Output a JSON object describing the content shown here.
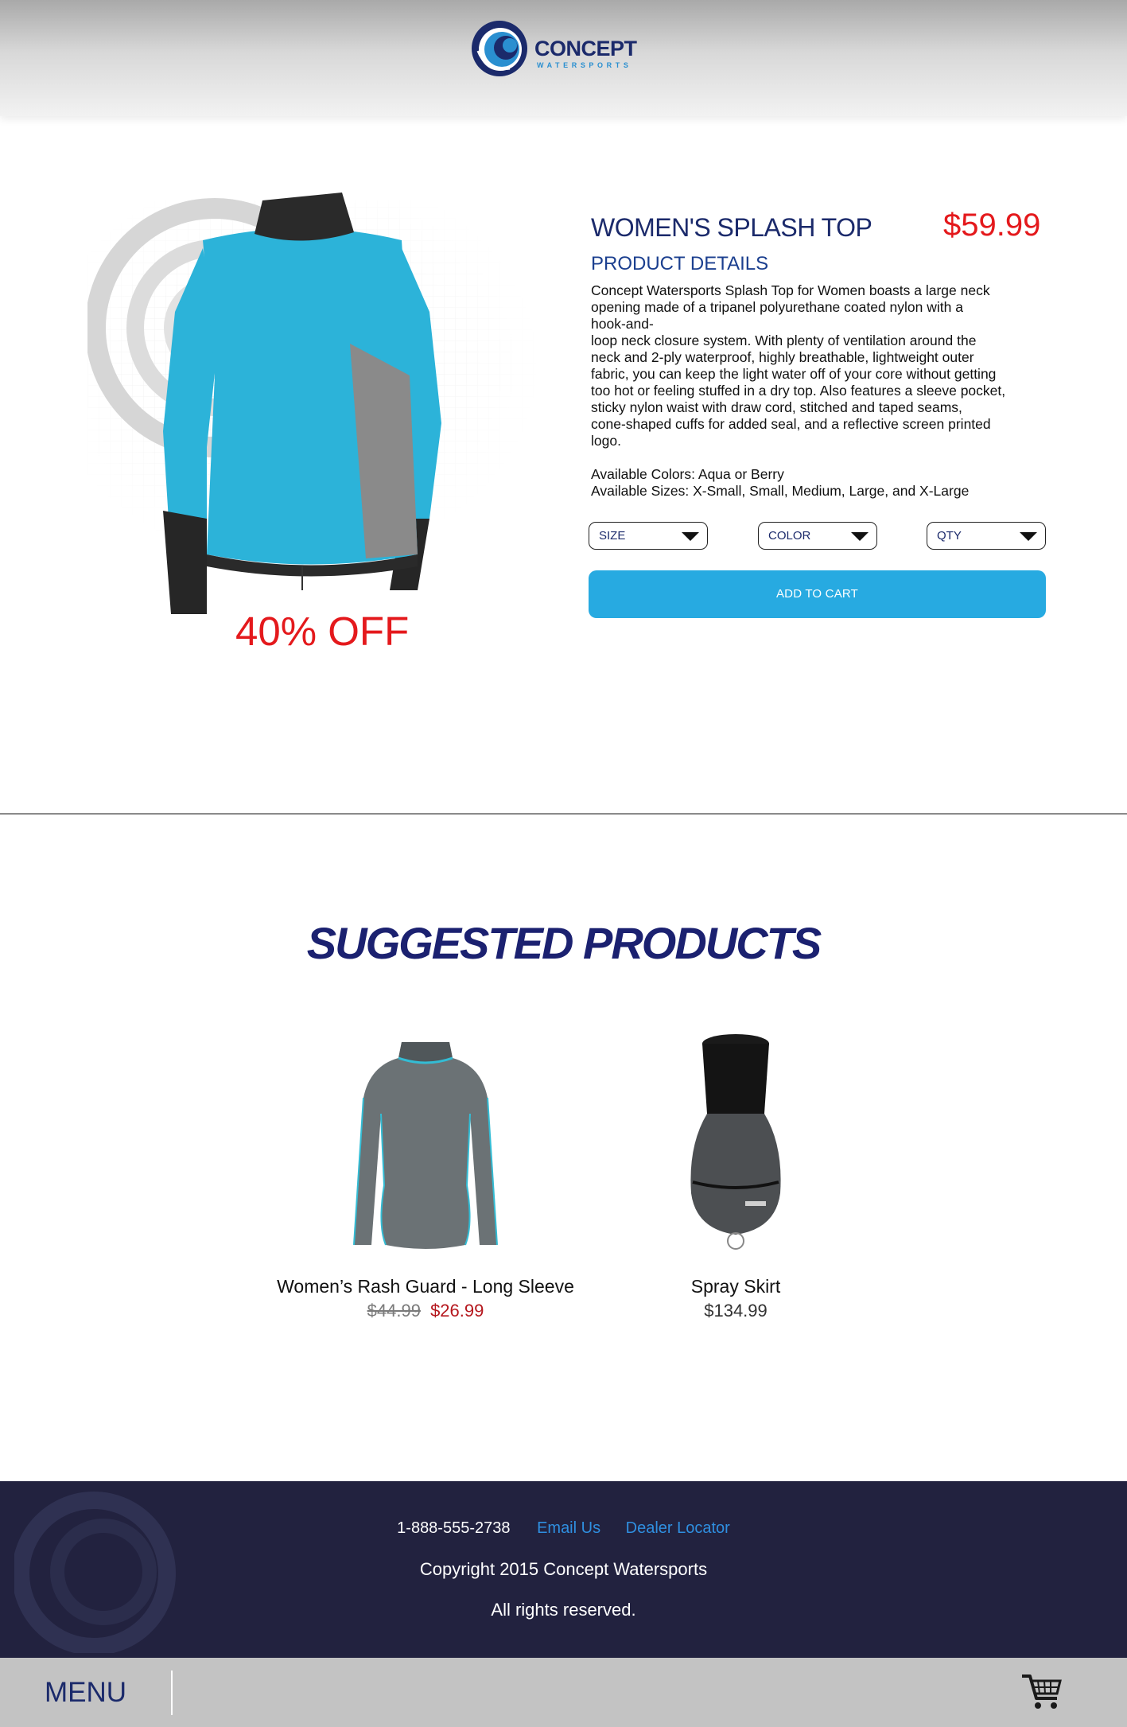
{
  "brand": {
    "name": "CONCEPT",
    "tagline": "WATERSPORTS",
    "colors": {
      "navy": "#1b2a6b",
      "accent_blue": "#27aae1",
      "sale_red": "#e4191c",
      "footer_bg": "#22223f"
    }
  },
  "product": {
    "title": "WOMEN'S SPLASH TOP",
    "price": "$59.99",
    "discount_label": "40% OFF",
    "details_heading": "PRODUCT DETAILS",
    "description_lines": [
      "Concept Watersports Splash Top for Women boasts a large neck",
      "opening made of a tripanel polyurethane coated nylon with a",
      "hook-and-",
      "loop neck closure system. With plenty of ventilation around the",
      "neck and  2-ply waterproof, highly breathable, lightweight outer",
      "fabric, you can keep the light water off of your core without getting",
      "too hot or feeling stuffed in a dry top. Also features a sleeve pocket,",
      "sticky nylon waist with draw cord, stitched and taped seams,",
      "cone-shaped cuffs for added seal, and a reflective screen printed",
      "logo."
    ],
    "available_colors": "Available Colors: Aqua or Berry",
    "available_sizes": "Available Sizes: X-Small, Small, Medium, Large, and X-Large",
    "selects": {
      "size": "SIZE",
      "color": "COLOR",
      "qty": "QTY"
    },
    "add_to_cart": "ADD TO CART",
    "image_icon": "aqua-splash-jacket"
  },
  "suggested": {
    "heading": "SUGGESTED PRODUCTS",
    "items": [
      {
        "name": "Women’s Rash Guard - Long Sleeve",
        "old_price": "$44.99",
        "sale_price": "$26.99",
        "image_icon": "rash-guard-shirt"
      },
      {
        "name": "Spray Skirt",
        "price": "$134.99",
        "image_icon": "spray-skirt"
      }
    ]
  },
  "footer": {
    "phone": "1-888-555-2738",
    "email_link": "Email Us",
    "dealer_link": "Dealer Locator",
    "copyright": "Copyright 2015 Concept Watersports",
    "rights": "All rights reserved."
  },
  "bottom_bar": {
    "menu_label": "MENU",
    "cart_icon": "shopping-cart-icon"
  }
}
